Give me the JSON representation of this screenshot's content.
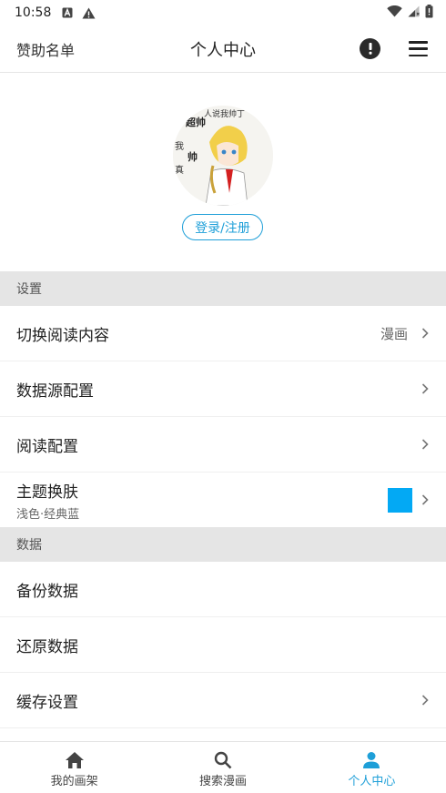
{
  "status_bar": {
    "time": "10:58"
  },
  "header": {
    "sponsor_label": "赞助名单",
    "title": "个人中心",
    "info_icon": "alert-circle-icon",
    "menu_icon": "hamburger-menu-icon"
  },
  "profile": {
    "login_label": "登录/注册",
    "avatar_text": [
      "人说我帅丁",
      "超帅",
      "我",
      "帅",
      "真"
    ]
  },
  "sections": {
    "settings": "设置",
    "data": "数据"
  },
  "settings_rows": [
    {
      "label": "切换阅读内容",
      "value": "漫画"
    },
    {
      "label": "数据源配置"
    },
    {
      "label": "阅读配置"
    },
    {
      "label": "主题换肤",
      "sub": "浅色·经典蓝",
      "swatch_color": "#03a9f4"
    }
  ],
  "data_rows": [
    {
      "label": "备份数据"
    },
    {
      "label": "还原数据"
    },
    {
      "label": "缓存设置"
    }
  ],
  "bottom_nav": [
    {
      "label": "我的画架",
      "icon": "home-icon"
    },
    {
      "label": "搜索漫画",
      "icon": "search-icon"
    },
    {
      "label": "个人中心",
      "icon": "person-icon",
      "active": true
    }
  ],
  "colors": {
    "accent": "#1e9fd8",
    "swatch": "#03a9f4",
    "section_bg": "#e5e5e5"
  }
}
